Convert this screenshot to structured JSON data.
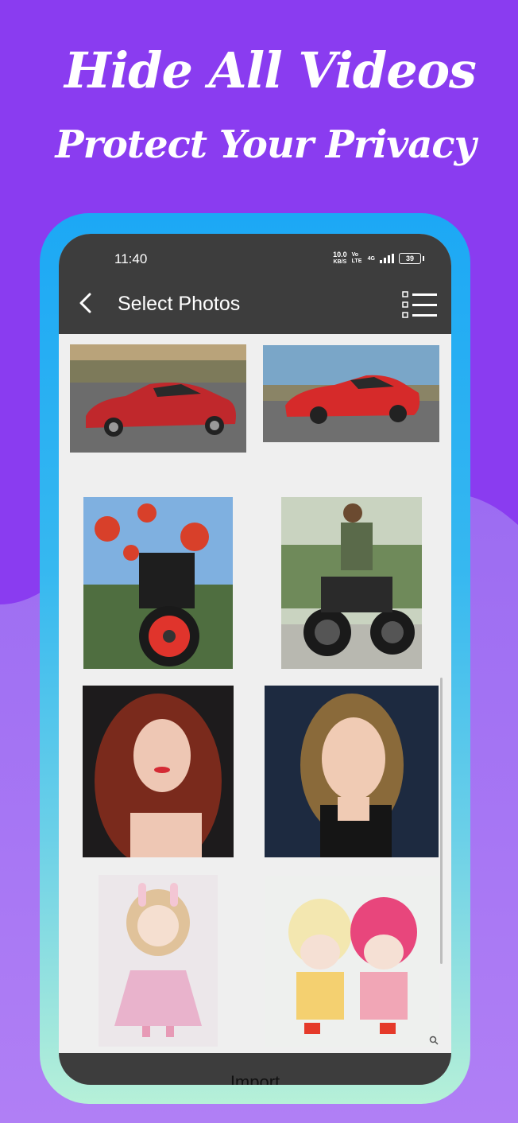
{
  "promo": {
    "headline": "Hide All Videos",
    "subheadline": "Protect Your Privacy"
  },
  "status_bar": {
    "time": "11:40",
    "net_speed": "10.0",
    "net_unit": "KB/S",
    "volte": "Vo LTE",
    "network": "4G",
    "battery": "39"
  },
  "app_bar": {
    "back_icon": "chevron-left-icon",
    "title": "Select Photos",
    "list_icon": "checklist-icon"
  },
  "grid": {
    "photos": [
      {
        "subject": "red sedan",
        "color": "#c0282c"
      },
      {
        "subject": "red sports car",
        "color": "#d62a2a"
      },
      {
        "subject": "motorbike with red flowers",
        "color": "#d8402a"
      },
      {
        "subject": "woman on motorcycle",
        "color": "#3a3a3a"
      },
      {
        "subject": "red-haired woman",
        "color": "#7a2a1c"
      },
      {
        "subject": "blonde woman",
        "color": "#1d2a40"
      },
      {
        "subject": "doll in pink dress",
        "color": "#e9c3d6"
      },
      {
        "subject": "knitted hat dolls",
        "color": "#e8467c"
      }
    ]
  },
  "footer": {
    "import_label": "Import"
  }
}
